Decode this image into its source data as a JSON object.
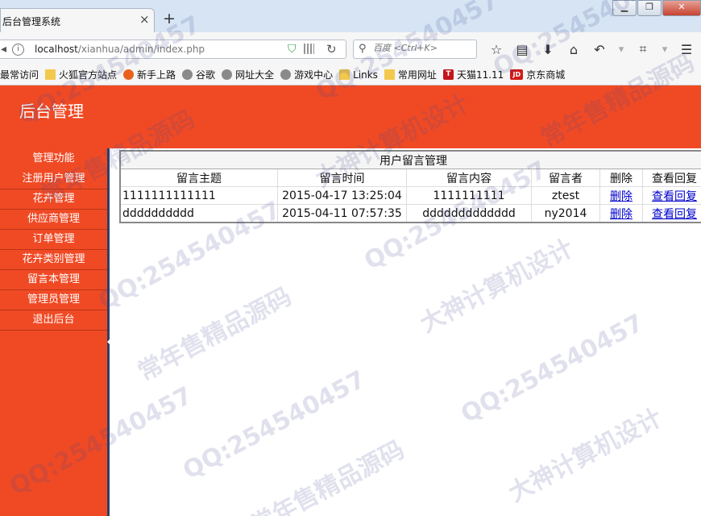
{
  "browser": {
    "tab_title": "后台管理系统",
    "tab_close": "×",
    "new_tab": "+",
    "window_buttons": [
      "▁",
      "❐",
      "✕"
    ],
    "url_host": "localhost",
    "url_path": "/xianhua/admin/index.php",
    "search_placeholder": "百度 <Ctrl+K>",
    "bookmarks": [
      {
        "label": "最常访问",
        "icon": "none"
      },
      {
        "label": "火狐官方站点",
        "icon": "folder-icon"
      },
      {
        "label": "新手上路",
        "icon": "firefox-icon"
      },
      {
        "label": "谷歌",
        "icon": "globe-icon"
      },
      {
        "label": "网址大全",
        "icon": "globe-icon"
      },
      {
        "label": "游戏中心",
        "icon": "globe-icon"
      },
      {
        "label": "Links",
        "icon": "folder-icon"
      },
      {
        "label": "常用网址",
        "icon": "folder-icon"
      },
      {
        "label": "天猫11.11",
        "icon": "tmall-icon",
        "badge": "T"
      },
      {
        "label": "京东商城",
        "icon": "jd-icon",
        "badge": "JD"
      }
    ]
  },
  "app": {
    "title": "后台管理",
    "sidebar": [
      "管理功能",
      "注册用户管理",
      "花卉管理",
      "供应商管理",
      "订单管理",
      "花卉类别管理",
      "留言本管理",
      "管理员管理",
      "退出后台"
    ],
    "table": {
      "caption": "用户留言管理",
      "headers": [
        "留言主题",
        "留言时间",
        "留言内容",
        "留言者",
        "删除",
        "查看回复"
      ],
      "rows": [
        {
          "subject": "1111111111111",
          "time": "2015-04-17 13:25:04",
          "content": "1111111111",
          "author": "ztest",
          "delete": "删除",
          "view": "查看回复"
        },
        {
          "subject": "dddddddddd",
          "time": "2015-04-11 07:57:35",
          "content": "ddddddddddddd",
          "author": "ny2014",
          "delete": "删除",
          "view": "查看回复"
        }
      ]
    }
  },
  "watermark": [
    "QQ:254540457",
    "大神计算机设计",
    "常年售精品源码"
  ],
  "colors": {
    "header_bg": "#f04a25",
    "sidebar_divider": "#2d3f67",
    "link": "#0000cc"
  }
}
